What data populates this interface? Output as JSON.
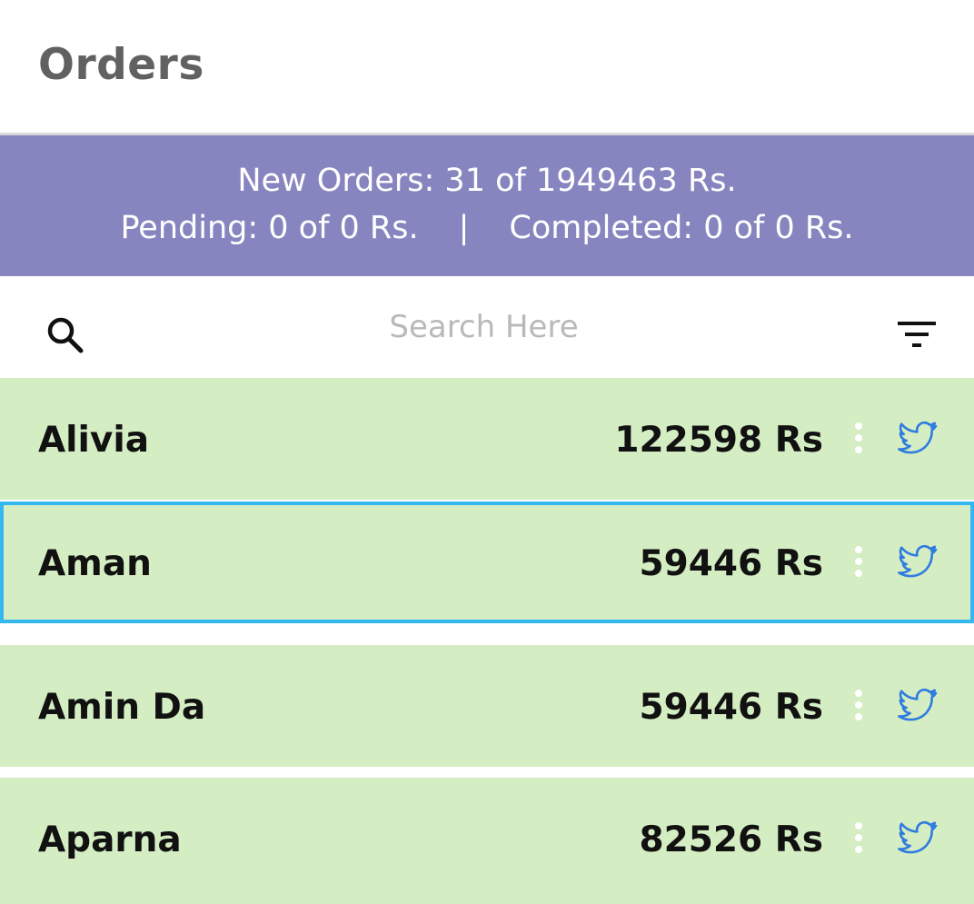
{
  "header": {
    "title": "Orders"
  },
  "summary": {
    "new_orders": "New Orders: 31 of 1949463 Rs.",
    "pending": "Pending: 0 of 0 Rs.",
    "separator": "|",
    "completed": "Completed: 0 of 0 Rs.",
    "background": "#8785bf"
  },
  "search": {
    "placeholder": "Search Here",
    "value": ""
  },
  "orders": [
    {
      "name": "Alivia",
      "amount": "122598 Rs",
      "selected": false
    },
    {
      "name": "Aman",
      "amount": "59446 Rs",
      "selected": true
    },
    {
      "name": "Amin Da",
      "amount": "59446 Rs",
      "selected": false
    },
    {
      "name": "Aparna",
      "amount": "82526 Rs",
      "selected": false
    }
  ],
  "icons": {
    "search": "search-icon",
    "filter": "filter-icon",
    "more": "more-vertical-icon",
    "share": "twitter-bird-icon"
  },
  "colors": {
    "row_background": "#d4edc3",
    "selection_border": "#34b8ef",
    "bird_icon": "#2f7be0"
  }
}
